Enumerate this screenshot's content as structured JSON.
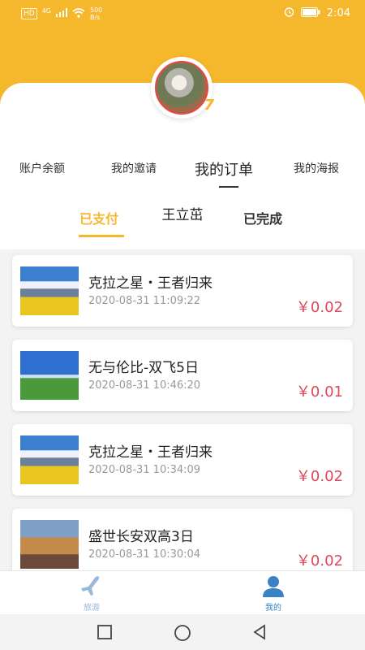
{
  "status_bar": {
    "sim_label": "HD",
    "network": "4G",
    "net_speed_value": "500",
    "net_speed_unit": "B/s",
    "time": "2:04",
    "icons": [
      "signal-icon",
      "wifi-icon",
      "alarm-icon",
      "battery-icon"
    ]
  },
  "profile": {
    "name": "王立茁",
    "avatar_badge": "7"
  },
  "menu": {
    "items": [
      {
        "label": "账户余额",
        "active": false
      },
      {
        "label": "我的邀请",
        "active": false
      },
      {
        "label": "我的订单",
        "active": true
      },
      {
        "label": "我的海报",
        "active": false
      }
    ]
  },
  "subtabs": [
    {
      "label": "已支付",
      "active": true
    },
    {
      "label": "已完成",
      "active": false
    }
  ],
  "orders": [
    {
      "title": "克拉之星・王者归来",
      "time": "2020-08-31 11:09:22",
      "price": "￥0.02",
      "thumb": "mountain"
    },
    {
      "title": "无与伦比-双飞5日",
      "time": "2020-08-31 10:46:20",
      "price": "￥0.01",
      "thumb": "yurt"
    },
    {
      "title": "克拉之星・王者归来",
      "time": "2020-08-31 10:34:09",
      "price": "￥0.02",
      "thumb": "mountain"
    },
    {
      "title": "盛世长安双高3日",
      "time": "2020-08-31 10:30:04",
      "price": "￥0.02",
      "thumb": "palace"
    }
  ],
  "bottom_nav": [
    {
      "label": "旅游",
      "icon": "airplane-icon",
      "active": false
    },
    {
      "label": "我的",
      "icon": "person-icon",
      "active": true
    }
  ],
  "system_nav": [
    "recents-button",
    "home-button",
    "back-button"
  ],
  "colors": {
    "brand_yellow": "#f5b82c",
    "price_red": "#e0475a",
    "active_nav_blue": "#3a82c4"
  }
}
